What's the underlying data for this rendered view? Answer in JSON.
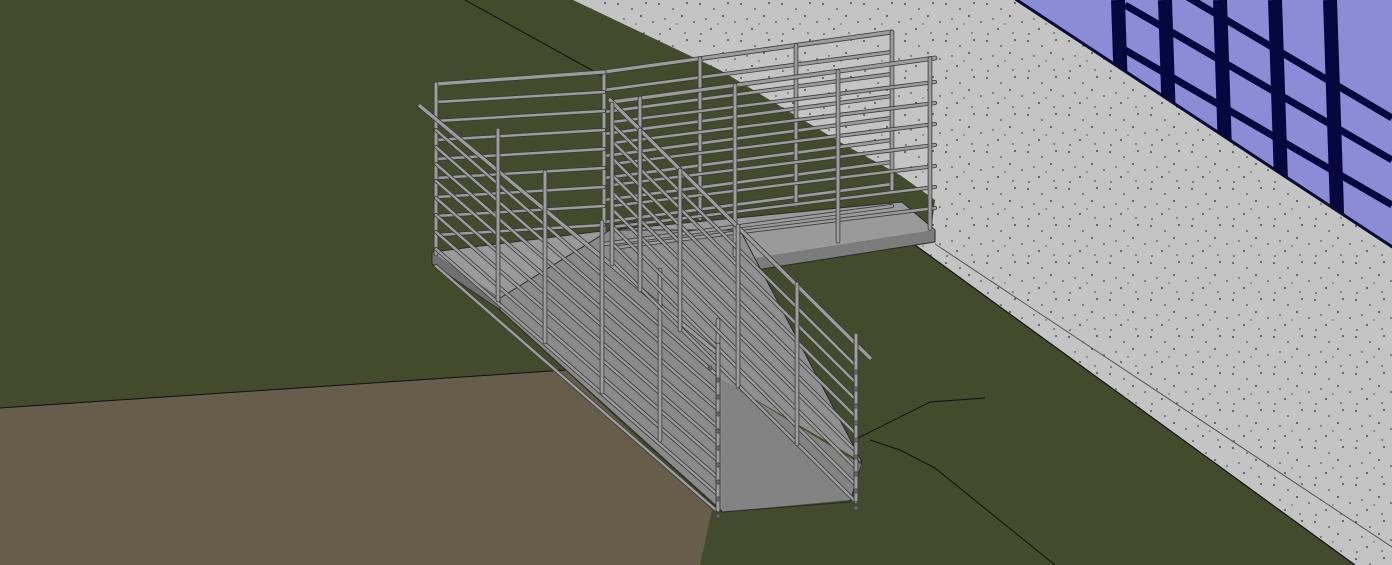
{
  "viewport": {
    "model_elements": [
      "grass-ground",
      "paved-ground",
      "concrete-walkway",
      "curtain-wall",
      "upper-landing",
      "ramp-slab",
      "ramp-railing",
      "landing-railing"
    ]
  },
  "colors": {
    "grass": "#444a2c",
    "paving": "#665e4b",
    "walkway": "#c4c4c4",
    "walkway_speckle": "#2b2b2b",
    "glass": "#8b8bd6",
    "mullion": "#07073f",
    "slab_top": "#9a9a9a",
    "slab_side": "#7c7c7c",
    "ramp_side": "#8a8a8a",
    "ramp_surface": "#838383",
    "rail": "#9c9c9c",
    "rail_edge": "#3a3a3a",
    "line": "#111111"
  }
}
